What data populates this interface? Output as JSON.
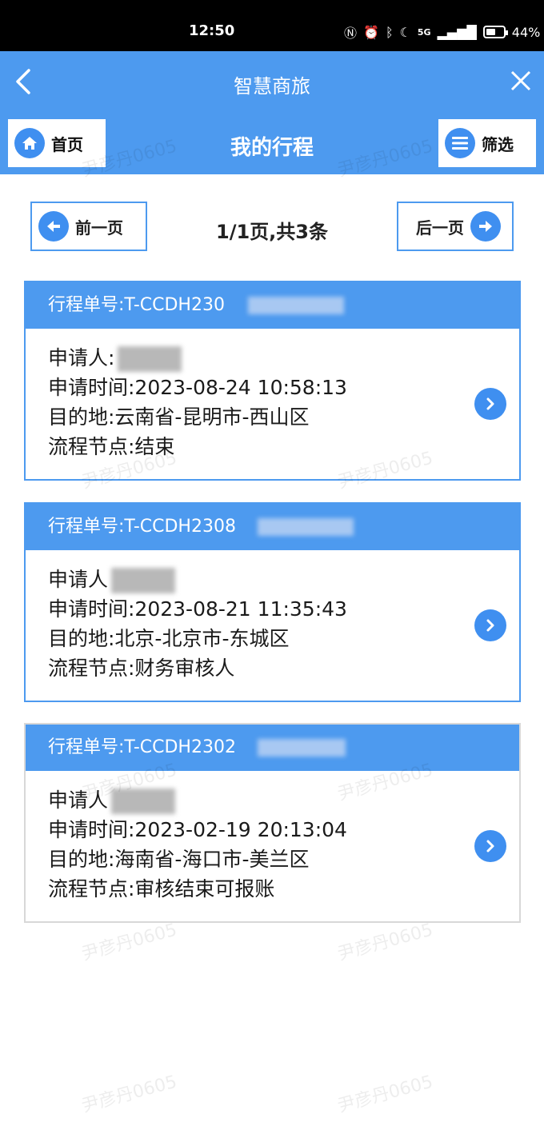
{
  "status": {
    "time": "12:50",
    "battery": "44%",
    "signal": "5G"
  },
  "app": {
    "title": "智慧商旅"
  },
  "toolbar": {
    "home_label": "首页",
    "page_title": "我的行程",
    "filter_label": "筛选"
  },
  "pager": {
    "prev_label": "前一页",
    "info": "1/1页,共3条",
    "next_label": "后一页"
  },
  "trips": [
    {
      "order_no": "行程单号:T-CCDH230",
      "applicant": "申请人:",
      "time": "申请时间:2023-08-24 10:58:13",
      "destination": "目的地:云南省-昆明市-西山区",
      "node": "流程节点:结束"
    },
    {
      "order_no": "行程单号:T-CCDH2308",
      "applicant": "申请人",
      "time": "申请时间:2023-08-21 11:35:43",
      "destination": "目的地:北京-北京市-东城区",
      "node": "流程节点:财务审核人"
    },
    {
      "order_no": "行程单号:T-CCDH2302",
      "applicant": "申请人",
      "time": "申请时间:2023-02-19 20:13:04",
      "destination": "目的地:海南省-海口市-美兰区",
      "node": "流程节点:审核结束可报账"
    }
  ],
  "watermark": "尹彦丹0605",
  "colors": {
    "accent": "#4d9aef",
    "icon_blue": "#3f8ff0"
  }
}
